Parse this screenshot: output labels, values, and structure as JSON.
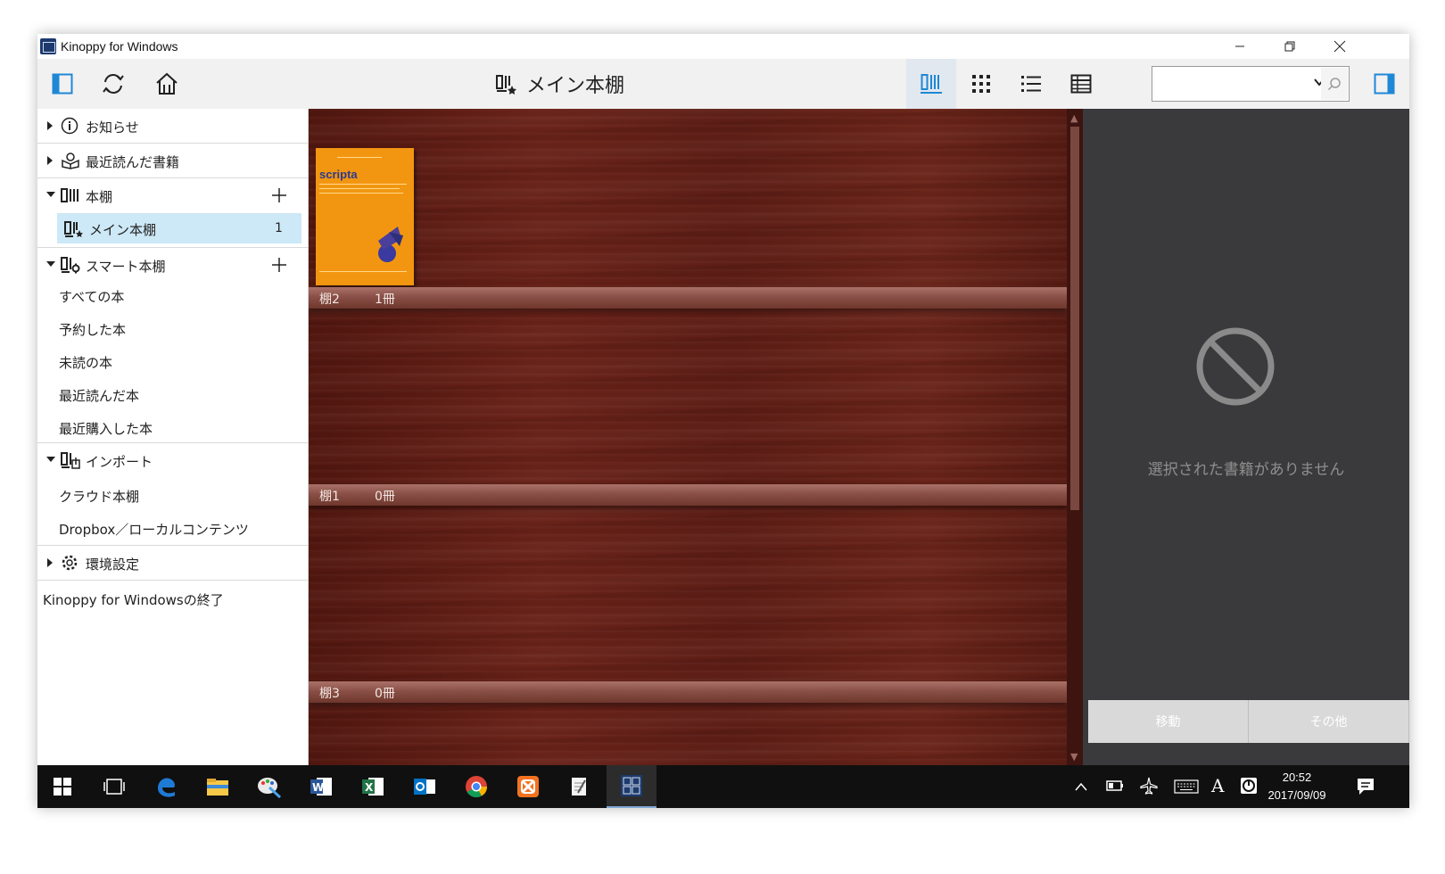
{
  "window": {
    "title": "Kinoppy for Windows",
    "controls": {
      "minimize": "−",
      "maximize": "❐",
      "close": "✕"
    }
  },
  "toolbar": {
    "shelf_title": "メイン本棚",
    "search": {
      "value": "",
      "placeholder": ""
    },
    "view_modes": [
      "bookshelf-view",
      "grid-view",
      "list-view",
      "table-view"
    ],
    "active_view": "bookshelf-view"
  },
  "sidebar": {
    "news": "お知らせ",
    "recent_books": "最近読んだ書籍",
    "bookshelves": {
      "label": "本棚",
      "items": [
        {
          "label": "メイン本棚",
          "count": "1",
          "selected": true
        }
      ]
    },
    "smart_shelves": {
      "label": "スマート本棚",
      "items": [
        "すべての本",
        "予約した本",
        "未読の本",
        "最近読んだ本",
        "最近購入した本"
      ]
    },
    "import": {
      "label": "インポート",
      "items": [
        "クラウド本棚",
        "Dropbox／ローカルコンテンツ"
      ]
    },
    "settings": "環境設定",
    "exit": "Kinoppy for Windowsの終了"
  },
  "bookshelf": {
    "shelves": [
      {
        "name": "棚2",
        "count": "1冊"
      },
      {
        "name": "棚1",
        "count": "0冊"
      },
      {
        "name": "棚3",
        "count": "0冊"
      }
    ],
    "book": {
      "cover_title": "scripta"
    }
  },
  "detail": {
    "empty_message": "選択された書籍がありません",
    "move_button": "移動",
    "other_button": "その他"
  },
  "taskbar": {
    "time": "20:52",
    "date": "2017/09/09",
    "ime": "A"
  },
  "colors": {
    "selection": "#cde8f6",
    "shelf_wood": "#5a1c14",
    "detail_bg": "#3a3a3c",
    "book_cover": "#f29611",
    "accent": "#1e88d6"
  }
}
